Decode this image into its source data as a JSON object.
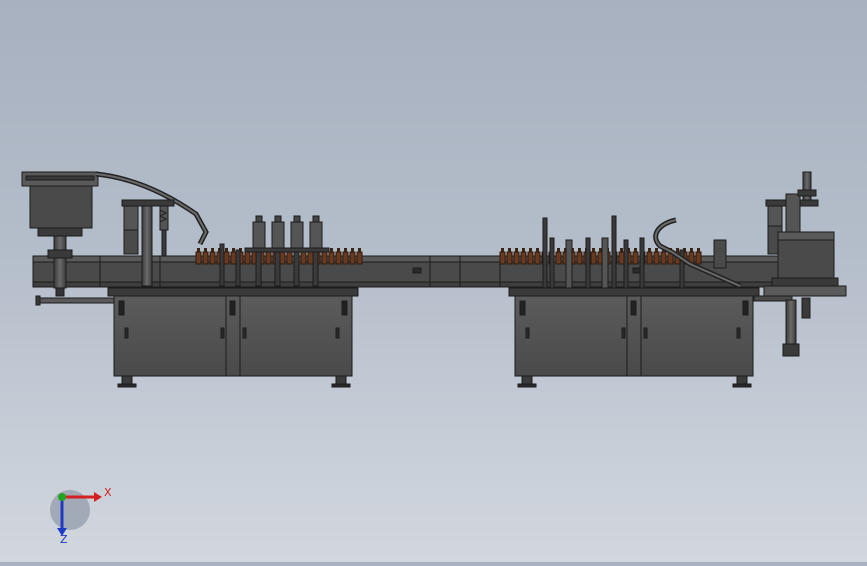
{
  "viewport": {
    "background_top": "#a7b1bf",
    "background_bottom": "#d2d7de"
  },
  "model": {
    "colors": {
      "frame": "#4a4a4a",
      "edge": "#1c1c1c",
      "cabinet": "#555555",
      "bottle": "#6b3a1e"
    }
  },
  "triad": {
    "x_label": "X",
    "z_label": "Z",
    "x_color": "#d42020",
    "y_color": "#1fa51f",
    "z_color": "#1f3bc4",
    "icon": "coordinate-triad-icon"
  }
}
